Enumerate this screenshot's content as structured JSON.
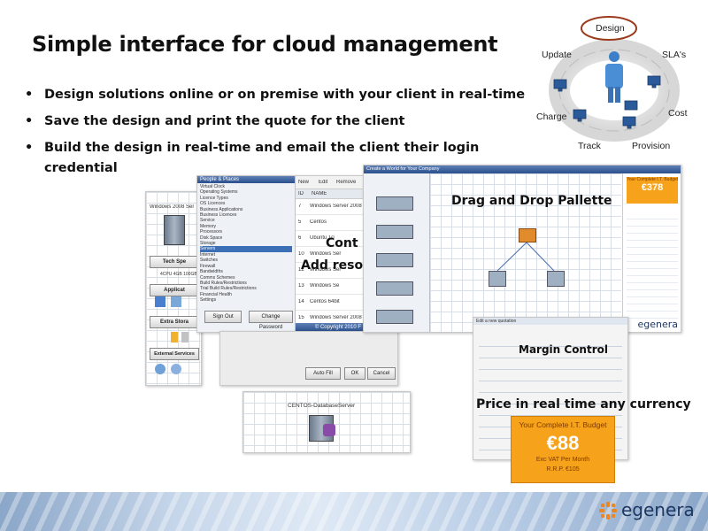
{
  "slide": {
    "title": "Simple interface for cloud management",
    "bullets": [
      "Design solutions online or on premise with your client in real-time",
      "Save the design and print the quote for the client",
      "Build the design in real-time and email the client their login credential"
    ]
  },
  "cycle": {
    "labels": [
      "Design",
      "SLA's",
      "Cost",
      "Provision",
      "Track",
      "Charge",
      "Update"
    ],
    "highlight": "Design",
    "highlight_color": "#9a3a1c",
    "arrow_color": "#e6e6e6"
  },
  "overlays": {
    "drag_drop": "Drag and Drop Pallette",
    "contact": "Cont",
    "add_resources": "Add reso",
    "margin_control": "Margin Control",
    "price_realtime": "Price in real time any currency"
  },
  "window_left": {
    "server_name": "Windows 2008 Ser",
    "tech_spec": "Tech Spe",
    "specs": "4CPU   4GB   100GB",
    "applications": "Applicat",
    "extra_storage": "Extra Stora",
    "external_services": "External Services"
  },
  "window_center": {
    "tree_header": "People & Places",
    "tree_items": [
      "Virtual Clock",
      "Operating Systems",
      "Licence Types",
      "OS Licences",
      "Business Applications",
      "Business Licences",
      "Service",
      "Memory",
      "Processors",
      "Disk Space",
      "Storage",
      "Servers",
      "Internet",
      "Switches",
      "Firewall",
      "Bandwidths",
      "Comms Schemes",
      "Build Rules/Restrictions",
      "Trial Build Rules/Restrictions",
      "Financial Health",
      "Settings"
    ],
    "selected_item": "Servers",
    "toolbar": [
      "New",
      "Edit",
      "Remove"
    ],
    "columns": [
      "ID",
      "NAME"
    ],
    "rows": [
      {
        "id": "7",
        "name": "Windows Server 2008 R2 - 32bit"
      },
      {
        "id": "5",
        "name": "Centos"
      },
      {
        "id": "6",
        "name": "Ubuntu 10"
      },
      {
        "id": "10",
        "name": "Windows Ser"
      },
      {
        "id": "12",
        "name": "Windows Ser"
      },
      {
        "id": "13",
        "name": "Windows Se"
      },
      {
        "id": "14",
        "name": "Centos 64bit"
      },
      {
        "id": "15",
        "name": "Windows Server 2008 R2 Web"
      }
    ],
    "sign_out": "Sign Out",
    "change_password": "Change Password",
    "copyright": "© Copyright 2010 F"
  },
  "window_right": {
    "title": "Create a World for Your Company",
    "budget_title": "Your Complete I.T. Budget",
    "budget_amount": "€378",
    "brand": "egenera"
  },
  "dialog_autofill": {
    "buttons": [
      "Auto Fill",
      "OK",
      "Cancel"
    ]
  },
  "server_card": {
    "name": "CENTOS-DatabaseServer"
  },
  "margin_window": {
    "title": "Edit a new quotation"
  },
  "budget_card": {
    "title": "Your Complete I.T. Budget",
    "amount": "€88",
    "vat_note": "Exc VAT Per Month",
    "rrp": "R.R.P. €105",
    "bg_color": "#f7a21b",
    "text_color": "#ffffff"
  },
  "footer": {
    "logo_text": "egenera"
  }
}
